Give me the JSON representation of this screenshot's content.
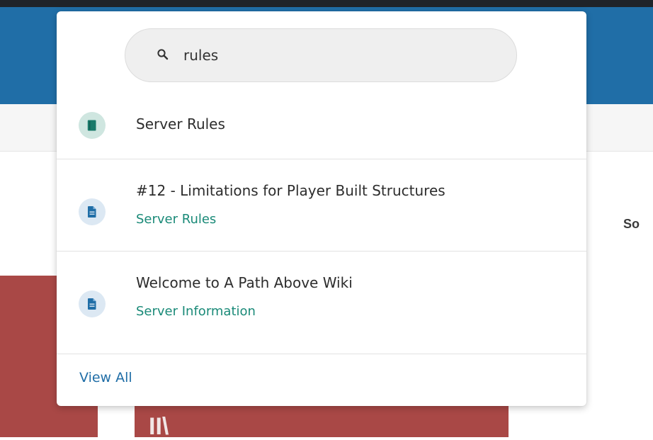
{
  "page": {
    "side_heading": "So",
    "red_glyph": "II\\"
  },
  "search": {
    "value": "rules",
    "icon": "search-icon"
  },
  "results": [
    {
      "title": "Server Rules",
      "subtitle": "",
      "icon": "book-icon",
      "badge_color": "#cfe6e0",
      "icon_color": "#1a7a6a"
    },
    {
      "title": "#12 - Limitations for Player Built Structures",
      "subtitle": "Server Rules",
      "icon": "page-icon",
      "badge_color": "#dce8f3",
      "icon_color": "#206ea7"
    },
    {
      "title": "Welcome to A Path Above Wiki",
      "subtitle": "Server Information",
      "icon": "page-icon",
      "badge_color": "#dce8f3",
      "icon_color": "#206ea7"
    }
  ],
  "footer": {
    "view_all_label": "View All"
  },
  "colors": {
    "header": "#206ea7",
    "accent_red": "#a94846",
    "subtitle_green": "#1a8a78",
    "link_blue": "#206ea7"
  }
}
